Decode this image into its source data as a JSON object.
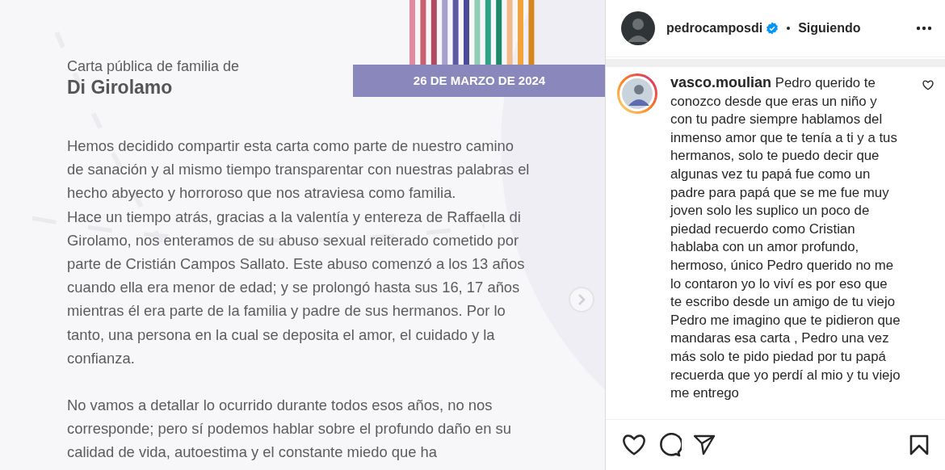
{
  "letter": {
    "kind": "document",
    "intro": "Carta pública de familia de",
    "family_name": "Di Girolamo",
    "date_banner": "26 DE MARZO DE 2024",
    "sections": [
      {
        "paragraphs": [
          "Hemos decidido compartir esta carta como parte de nuestro camino de sanación y al mismo tiempo transparentar con nuestras palabras el hecho abyecto y horroroso que nos atraviesa como familia.",
          "Hace un tiempo atrás, gracias a la valentía y entereza de Raffaella di Girolamo, nos enteramos de su abuso sexual reiterado cometido por parte de Cristián Campos Sallato. Este abuso comenzó a los 13 años cuando ella era menor de edad; y se prolongó hasta sus 16, 17 años mientras él era parte de la familia y padre de sus hermanos. Por lo tanto, una persona en la cual se deposita el amor, el cuidado y la confianza."
        ]
      },
      {
        "paragraphs": [
          "No vamos a detallar lo ocurrido durante todos esos años, no nos corresponde; pero sí podemos hablar sobre el profundo daño en su calidad de vida, autoestima y el constante miedo que ha"
        ]
      }
    ]
  },
  "post_header": {
    "username": "pedrocamposdi",
    "verified": true,
    "follow_status": "Siguiendo"
  },
  "comments": [
    {
      "username": "vasco.moulian",
      "story_ring": true,
      "liked": false,
      "text": "Pedro querido te conozco desde que eras un niño y con tu padre siempre hablamos del inmenso amor que te tenía a ti y a tus hermanos, solo te puedo decir que algunas vez tu papá fue como un padre para papá que se me fue muy joven solo les suplico un poco de piedad recuerdo como Cristian hablaba con un amor profundo, hermoso, único Pedro querido no me lo contaron yo lo viví es por eso que te escribo desde un amigo de tu viejo Pedro me imagino que te pidieron que mandaras esa carta , Pedro una vez más solo te pido piedad por tu papá recuerda que yo perdí al mio y tu viejo me entrego"
    }
  ],
  "actions": {
    "liked": false,
    "saved": false
  }
}
